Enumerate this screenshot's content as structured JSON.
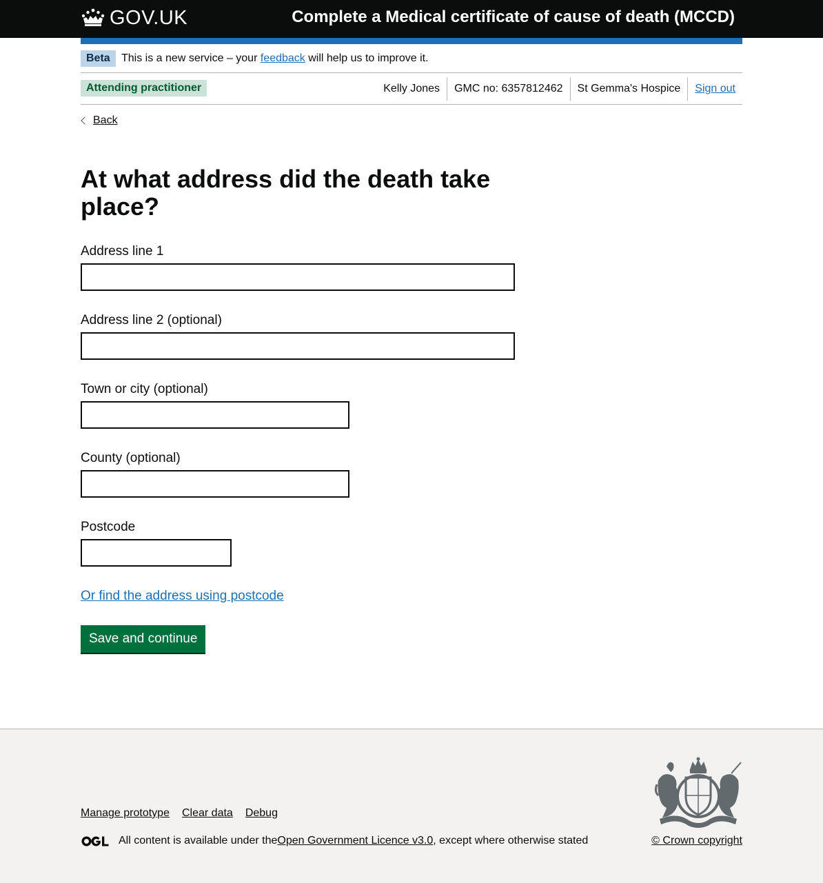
{
  "header": {
    "logo_text": "GOV.UK",
    "service_name": "Complete a Medical certificate of cause of death (MCCD)"
  },
  "phase_banner": {
    "tag": "Beta",
    "text_before": "This is a new service – your ",
    "link": "feedback",
    "text_after": " will help us to improve it."
  },
  "user_bar": {
    "role": "Attending practitioner",
    "name": "Kelly Jones",
    "gmc": "GMC no: 6357812462",
    "organisation": "St Gemma's Hospice",
    "sign_out": "Sign out"
  },
  "back_link": "Back",
  "page_title": "At what address did the death take place?",
  "form": {
    "address_line_1": {
      "label": "Address line 1",
      "value": ""
    },
    "address_line_2": {
      "label": "Address line 2 (optional)",
      "value": ""
    },
    "town": {
      "label": "Town or city (optional)",
      "value": ""
    },
    "county": {
      "label": "County (optional)",
      "value": ""
    },
    "postcode": {
      "label": "Postcode",
      "value": ""
    },
    "find_link": "Or find the address using postcode",
    "submit": "Save and continue"
  },
  "footer": {
    "links": [
      "Manage prototype",
      "Clear data",
      "Debug"
    ],
    "licence_before": "All content is available under the ",
    "licence_link": "Open Government Licence v3.0",
    "licence_after": ", except where otherwise stated",
    "copyright": "© Crown copyright"
  },
  "colors": {
    "header_bg": "#0b0c0c",
    "header_bar": "#1d70b8",
    "link": "#1d70b8",
    "button": "#00703c",
    "beta_tag_bg": "#bbd4ea",
    "role_tag_bg": "#cce2d8",
    "footer_bg": "#f3f2f1"
  },
  "icons": [
    "crown-icon",
    "chevron-left-icon",
    "ogl-logo-icon",
    "royal-coat-of-arms-icon"
  ]
}
